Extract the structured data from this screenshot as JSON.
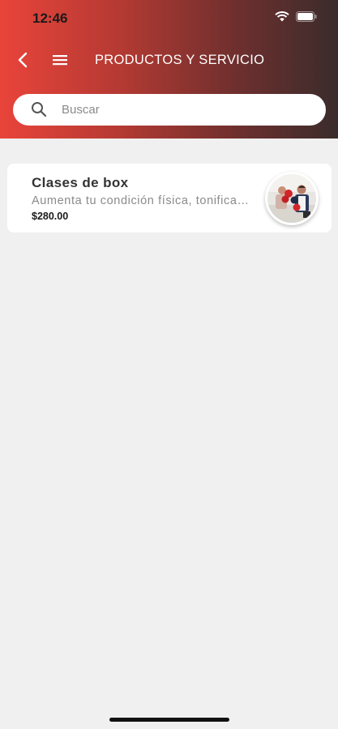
{
  "status_bar": {
    "time": "12:46"
  },
  "header": {
    "title": "PRODUCTOS Y SERVICIO"
  },
  "search": {
    "placeholder": "Buscar"
  },
  "products": [
    {
      "name": "Clases de box",
      "description": "Aumenta tu condición física, tonifica…",
      "price": "$280.00",
      "image": "boxing-class-photo"
    }
  ],
  "colors": {
    "header_gradient_start": "#e9443a",
    "header_gradient_end": "#3a2c2c",
    "background": "#f0f0f0"
  },
  "icons": [
    "back-icon",
    "menu-icon",
    "search-icon",
    "wifi-icon",
    "battery-icon"
  ]
}
